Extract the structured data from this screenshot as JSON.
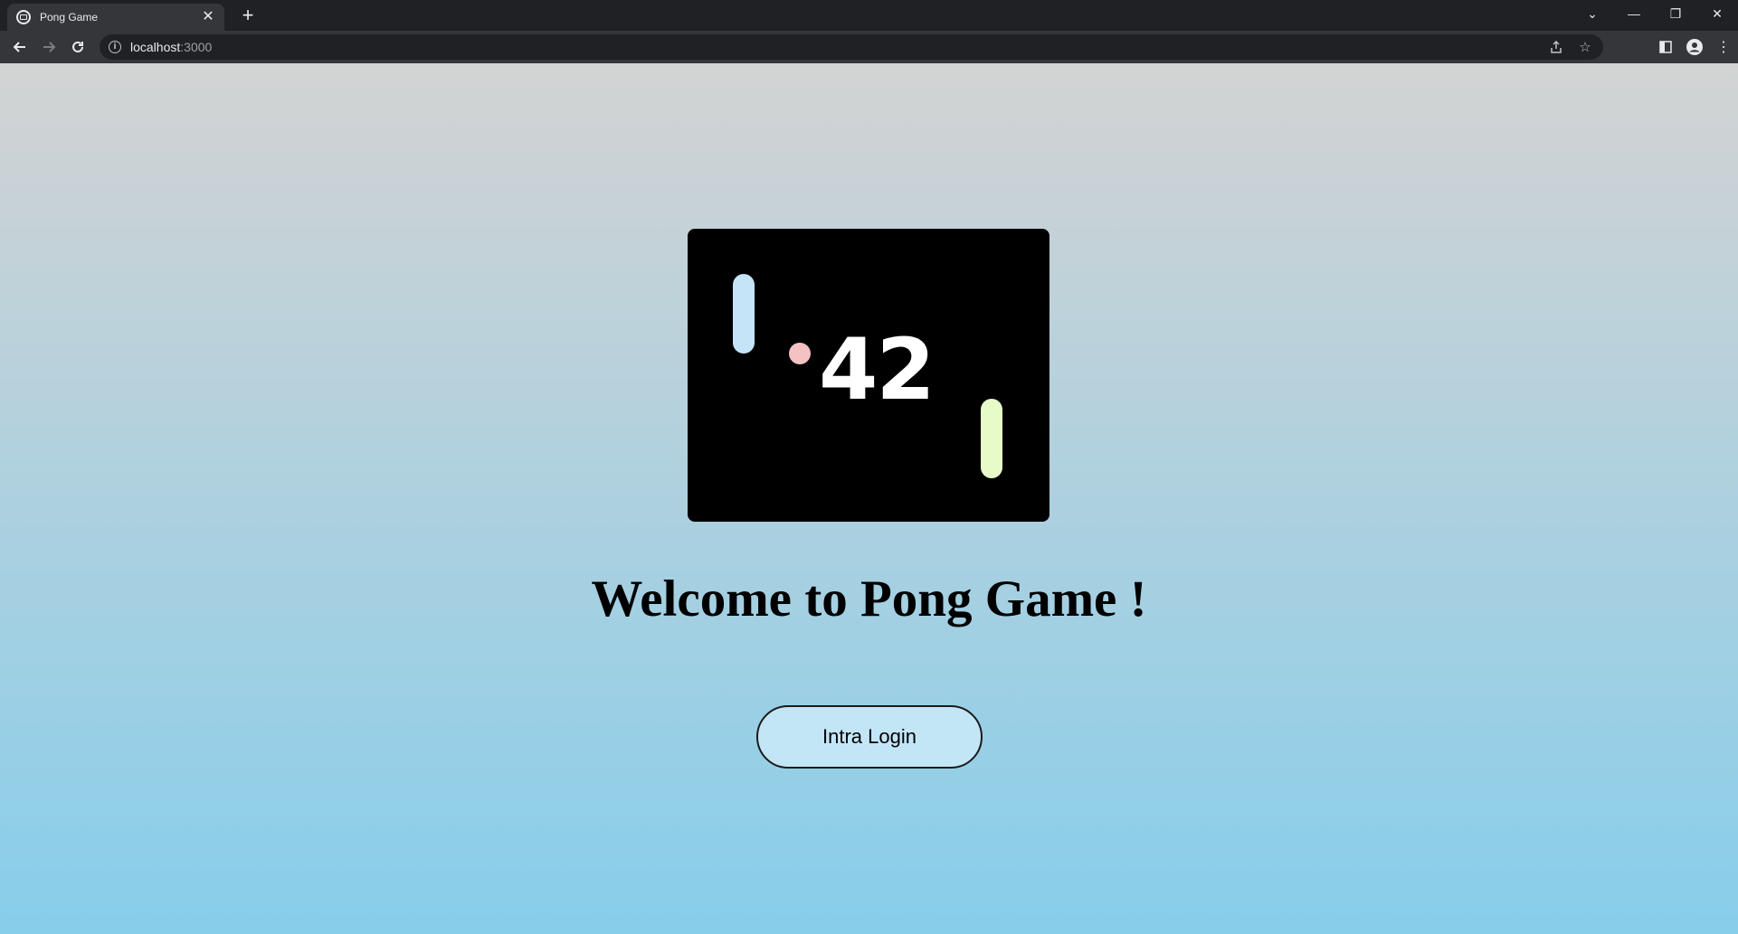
{
  "browser": {
    "tab": {
      "title": "Pong Game",
      "favicon_icon": "page-icon",
      "close_icon": "close-icon"
    },
    "new_tab_icon": "plus-icon",
    "window_controls": [
      "tab-search-icon",
      "minimize-icon",
      "restore-icon",
      "close-icon"
    ],
    "nav": {
      "back_icon": "back-arrow-icon",
      "forward_icon": "forward-arrow-icon",
      "reload_icon": "reload-icon"
    },
    "address": {
      "host": "localhost",
      "port": ":3000",
      "info_icon": "info-icon"
    },
    "omnibox_actions": [
      "share-icon",
      "star-icon"
    ],
    "toolbar_actions": [
      "side-panel-icon",
      "profile-icon",
      "kebab-menu-icon"
    ]
  },
  "page": {
    "logo": {
      "text": "42",
      "left_paddle_color": "#c5e4f7",
      "right_paddle_color": "#e6fbc8",
      "ball_color": "#f4c2c2"
    },
    "headline": "Welcome to Pong Game !",
    "login_button": "Intra Login",
    "background_gradient": [
      "#d3d3d3",
      "#87ceeb"
    ]
  }
}
